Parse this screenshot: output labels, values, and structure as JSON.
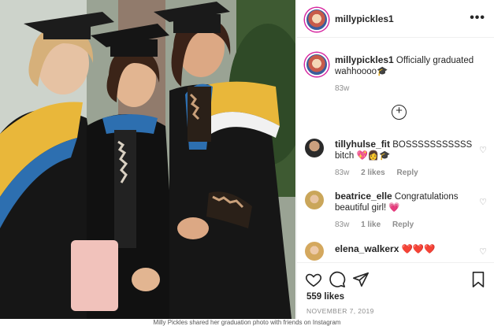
{
  "post": {
    "author": "millypickles1",
    "more_icon": "more-dots-icon",
    "caption_text": "Officially graduated wahhoooo🎓",
    "caption_time": "83w",
    "load_more_icon": "plus-circle-icon",
    "comments": [
      {
        "username": "tillyhulse_fit",
        "text": "BOSSSSSSSSSSS bitch 💖👩🎓",
        "time": "83w",
        "likes": "2 likes",
        "reply": "Reply"
      },
      {
        "username": "beatrice_elle",
        "text": "Congratulations beautiful girl! 💗",
        "time": "83w",
        "likes": "1 like",
        "reply": "Reply"
      },
      {
        "username": "elena_walkerx",
        "text": "❤️❤️❤️"
      }
    ],
    "likes_count": "559 likes",
    "date": "NOVEMBER 7, 2019"
  },
  "footer": {
    "credit": "Milly Pickles shared her graduation photo with friends on Instagram"
  },
  "colors": {
    "border": "#efefef",
    "muted": "#8e8e8e",
    "text": "#262626",
    "gown_yellow": "#e9b73a",
    "gown_blue": "#2d6fb0",
    "gown_black": "#161616"
  }
}
